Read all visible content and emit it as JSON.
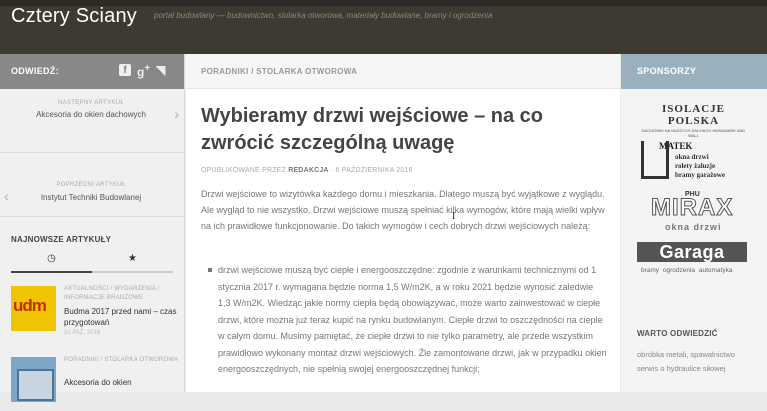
{
  "header": {
    "title": "Cztery Sciany",
    "tagline": "portal budowlany — budownictwo, stolarka otworowa, materiały budowlane, bramy i ogrodzenia"
  },
  "left_sidebar": {
    "visit_label": "ODWIEDŹ:",
    "social_icons": [
      "facebook-icon",
      "google-plus-icon",
      "rss-icon"
    ],
    "next": {
      "label": "NASTĘPNY ARTYKUŁ",
      "title": "Akcesoria do okien dachowych"
    },
    "prev": {
      "label": "POPRZEDNI ARTYKUŁ",
      "title": "Instytut Techniki Budowlanej"
    },
    "newest_label": "NAJNOWSZE ARTYKUŁY",
    "tabs": [
      "clock-icon",
      "star-icon"
    ],
    "posts": [
      {
        "category": "AKTUALNOŚCI / WYDARZENIA / INFORMACJE BRANŻOWE",
        "title": "Budma 2017 przed nami – czas przygotowań",
        "date": "31 PAŹ, 2016",
        "thumb_text": "udm"
      },
      {
        "category": "PORADNIKI / STOLARKA OTWOROWA",
        "title": "Akcesoria do okien",
        "date": ""
      }
    ]
  },
  "main": {
    "breadcrumb": "PORADNIKI / STOLARKA OTWOROWA",
    "title": "Wybieramy drzwi wejściowe – na co zwrócić szczególną uwagę",
    "meta_prefix": "OPUBLIKOWANE PRZEZ",
    "meta_author": "REDAKCJA",
    "meta_date": "· 6 PAŹDZIERNIKA 2016",
    "intro": "Drzwi wejściowe to wizytówka każdego domu i mieszkania. Dlatego muszą być wyjątkowe z wyglądu. Ale wygląd to nie wszystko. Drzwi wejściowe muszą spełniać kilka wymogów, które mają wielki wpływ na ich prawidłowe funkcjonowanie. Do takich wymogów i cech dobrych drzwi wejściowych należą:",
    "bullet": "drzwi wejściowe muszą być ciepłe i energooszczędne: zgodnie z warunkami technicznymi od 1 stycznia 2017 r. wymagana będzie norma 1,5 W/m2K, a w roku 2021 będzie wynosić zaledwie 1,3 W/m2K. Wiedząc jakie normy ciepła będą obowiązywać, może warto zainwestować w ciepłe drzwi, które można już teraz kupić na rynku budowlanym. Ciepłe drzwi to oszczędności na cieple w całym domu. Musimy pamiętać, że ciepłe drzwi to nie tylko parametry, ale przede wszystkim prawidłowo wykonany montaż drzwi wejściowych. Źle zamontowane drzwi, jak w przypadku okien energooszczędnych, nie spełnią swojej energooszczędnej funkcji;"
  },
  "right_sidebar": {
    "sponsors_label": "SPONSORZY",
    "isolacje": {
      "name": "ISOLACJE POLSKA",
      "sub": "DACHÓWKI NA NASZYCH DACHACH WANDMARK AND WALL"
    },
    "matek": {
      "name": "MATEK",
      "lines": [
        "okna drzwi",
        "rolety żaluzje",
        "bramy garażowe"
      ]
    },
    "mirax": {
      "prefix": "PHU",
      "name": "MIRAX",
      "sub": "okna drzwi"
    },
    "garaga": {
      "name": "Garaga",
      "sub": "bramy ogrodzenia automatyka"
    },
    "visit_label": "WARTO ODWIEDZIĆ",
    "links": [
      "obróbka metali, spawalnictwo",
      "serwis o hydraulice siłowej"
    ]
  },
  "colors": {
    "header_bg": "#3d3a32",
    "left_head_bg": "#888888",
    "sponsor_head_bg": "#9ab0bd"
  }
}
